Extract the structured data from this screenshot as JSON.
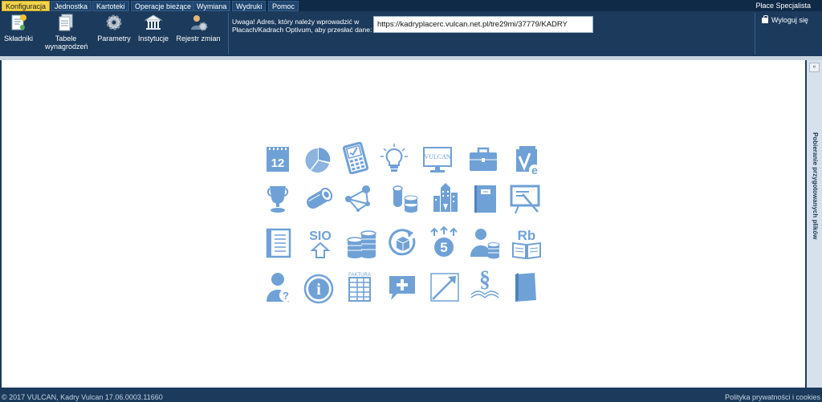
{
  "menu": {
    "items": [
      {
        "label": "Konfiguracja",
        "active": true
      },
      {
        "label": "Jednostka"
      },
      {
        "label": "Kartoteki"
      },
      {
        "label": "Operacje bieżące"
      },
      {
        "label": "Wymiana"
      },
      {
        "label": "Wydruki"
      },
      {
        "label": "Pomoc"
      }
    ],
    "app_name": "Płace Specjalista"
  },
  "ribbon": {
    "buttons": [
      {
        "label": "Składniki",
        "icon": "components-icon"
      },
      {
        "label": "Tabele wynagrodzeń",
        "icon": "salary-tables-icon"
      },
      {
        "label": "Parametry",
        "icon": "gear-icon"
      },
      {
        "label": "Instytucje",
        "icon": "institution-icon"
      },
      {
        "label": "Rejestr zmian",
        "icon": "change-log-icon"
      }
    ],
    "warning": "Uwaga! Adres, który należy wprowadzić w Płacach/Kadrach Optivum, aby przesłać dane:",
    "url_value": "https://kadryplacerc.vulcan.net.pl/tre29mi/37779/KADRY",
    "logout_label": "Wyloguj się"
  },
  "tiles": [
    "calendar-12-icon",
    "pie-chart-icon",
    "calculator-check-icon",
    "lightbulb-icon",
    "vulcan-monitor-icon",
    "briefcase-icon",
    "e-journal-icon",
    "trophy-icon",
    "money-roll-icon",
    "network-icon",
    "coins-roll-icon",
    "buildings-icon",
    "book-icon",
    "presentation-icon",
    "register-icon",
    "sio-upload-icon",
    "coin-stack-icon",
    "refresh-box-icon",
    "five-arrows-icon",
    "person-coins-icon",
    "rb-book-icon",
    "help-person-icon",
    "info-icon",
    "invoice-icon",
    "chat-plus-icon",
    "growth-chart-icon",
    "paragraph-icon",
    "folder-icon"
  ],
  "tile_text": {
    "calendar": "12",
    "vulcan": "VULCAN",
    "sio": "SIO",
    "five": "5",
    "rb": "Rb",
    "info": "i",
    "faktura": "FAKTURA",
    "paragraph": "§",
    "help": "?",
    "e": "e"
  },
  "side_panel": {
    "label": "Pobieranie przygotowanych plików"
  },
  "footer": {
    "left": "© 2017 VULCAN, Kadry Vulcan 17.06.0003.11660",
    "right": "Polityka prywatności i cookies"
  },
  "colors": {
    "navy": "#1b3a5c",
    "accent": "#f2d34a",
    "icon_blue": "#6fa1d6"
  }
}
